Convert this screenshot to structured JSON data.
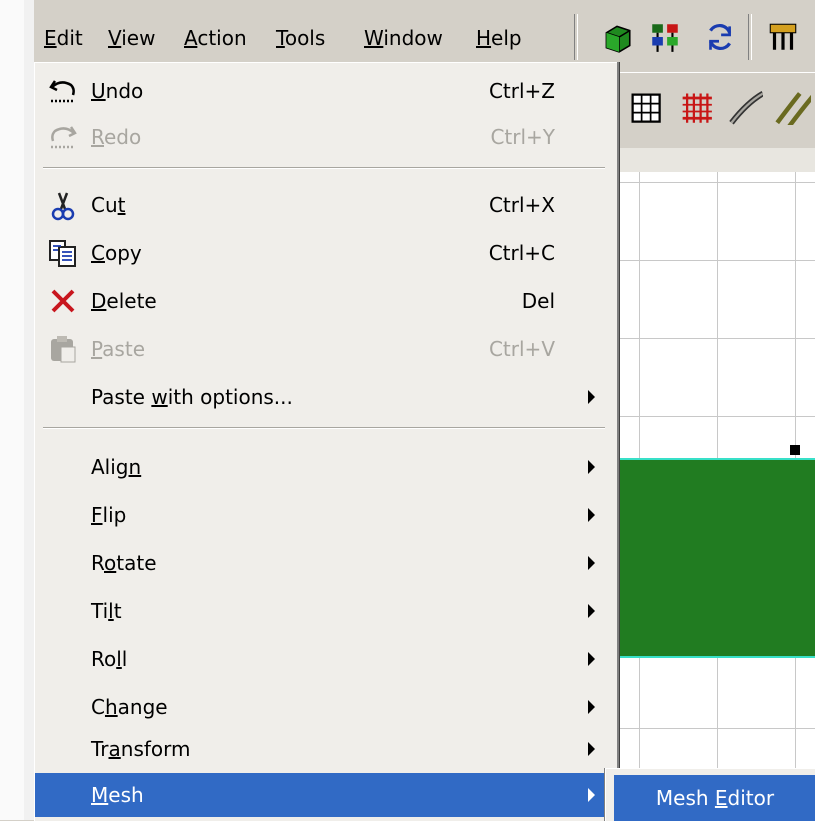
{
  "menubar": {
    "items": [
      {
        "name": "menu-edit",
        "pre": "",
        "u": "E",
        "post": "dit"
      },
      {
        "name": "menu-view",
        "pre": "",
        "u": "V",
        "post": "iew"
      },
      {
        "name": "menu-action",
        "pre": "",
        "u": "A",
        "post": "ction"
      },
      {
        "name": "menu-tools",
        "pre": "",
        "u": "T",
        "post": "ools"
      },
      {
        "name": "menu-window",
        "pre": "",
        "u": "W",
        "post": "indow"
      },
      {
        "name": "menu-help",
        "pre": "",
        "u": "H",
        "post": "elp"
      }
    ]
  },
  "toolbar_icons": [
    "cube-icon",
    "tree-icon",
    "refresh-icon",
    "tool-icon"
  ],
  "toolbar2_icons": [
    "grid-icon",
    "hatch-grid-icon",
    "line-tool-icon",
    "double-line-tool-icon"
  ],
  "edit_menu": {
    "groups": [
      [
        {
          "pre": "",
          "u": "U",
          "post": "ndo",
          "shortcut": "Ctrl+Z",
          "icon": "undo-icon",
          "disabled": false,
          "submenu": false
        },
        {
          "pre": "",
          "u": "R",
          "post": "edo",
          "shortcut": "Ctrl+Y",
          "icon": "redo-icon",
          "disabled": true,
          "submenu": false
        }
      ],
      [
        {
          "pre": "Cu",
          "u": "t",
          "post": "",
          "shortcut": "Ctrl+X",
          "icon": "cut-icon",
          "disabled": false,
          "submenu": false
        },
        {
          "pre": "",
          "u": "C",
          "post": "opy",
          "shortcut": "Ctrl+C",
          "icon": "copy-icon",
          "disabled": false,
          "submenu": false
        },
        {
          "pre": "",
          "u": "D",
          "post": "elete",
          "shortcut": "Del",
          "icon": "delete-icon",
          "disabled": false,
          "submenu": false
        },
        {
          "pre": "",
          "u": "P",
          "post": "aste",
          "shortcut": "Ctrl+V",
          "icon": "paste-icon",
          "disabled": true,
          "submenu": false
        },
        {
          "pre": "Paste ",
          "u": "w",
          "post": "ith options...",
          "shortcut": "",
          "icon": "",
          "disabled": false,
          "submenu": true
        }
      ],
      [
        {
          "pre": "Alig",
          "u": "n",
          "post": "",
          "shortcut": "",
          "icon": "",
          "disabled": false,
          "submenu": true
        },
        {
          "pre": "",
          "u": "F",
          "post": "lip",
          "shortcut": "",
          "icon": "",
          "disabled": false,
          "submenu": true
        },
        {
          "pre": "R",
          "u": "o",
          "post": "tate",
          "shortcut": "",
          "icon": "",
          "disabled": false,
          "submenu": true
        },
        {
          "pre": "Ti",
          "u": "l",
          "post": "t",
          "shortcut": "",
          "icon": "",
          "disabled": false,
          "submenu": true
        },
        {
          "pre": "Ro",
          "u": "l",
          "post": "l",
          "shortcut": "",
          "icon": "",
          "disabled": false,
          "submenu": true
        },
        {
          "pre": "C",
          "u": "h",
          "post": "ange",
          "shortcut": "",
          "icon": "",
          "disabled": false,
          "submenu": true
        },
        {
          "pre": "Tr",
          "u": "a",
          "post": "nsform",
          "shortcut": "",
          "icon": "",
          "disabled": false,
          "submenu": true
        },
        {
          "pre": "",
          "u": "M",
          "post": "esh",
          "shortcut": "",
          "icon": "",
          "disabled": false,
          "submenu": true,
          "highlighted": true
        }
      ]
    ]
  },
  "submenu": {
    "pre": "Mesh ",
    "u": "E",
    "post": "ditor"
  },
  "colors": {
    "highlight": "#316ac5",
    "shape_fill": "#217c21",
    "shape_edge": "#38e0c8",
    "menu_bg": "#f0eeea"
  }
}
